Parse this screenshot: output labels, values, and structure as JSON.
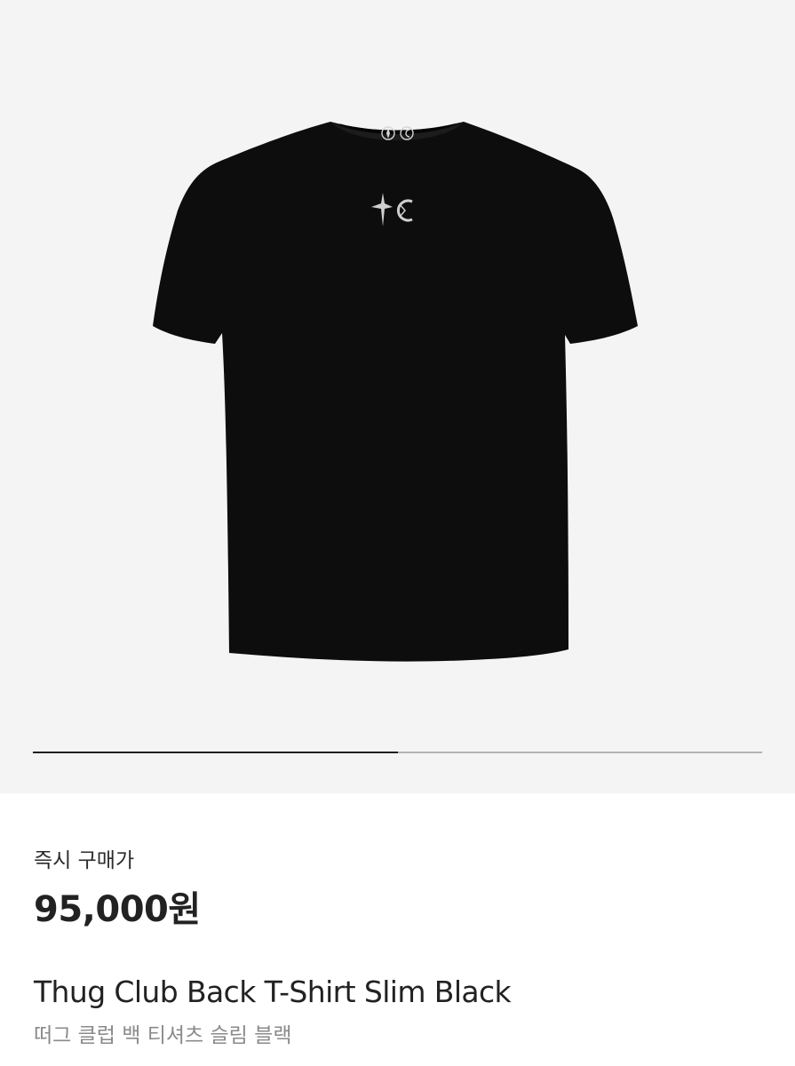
{
  "gallery": {
    "image_icon": "black-tshirt-image",
    "slide_progress": 0.5,
    "progress_fill_color": "#1f1f1f",
    "progress_track_color": "#b3b3b3"
  },
  "product": {
    "price_label": "즉시 구매가",
    "price": "95,000원",
    "name_en": "Thug Club Back T-Shirt Slim Black",
    "name_ko": "떠그 클럽 백 티셔츠 슬림 블랙"
  }
}
